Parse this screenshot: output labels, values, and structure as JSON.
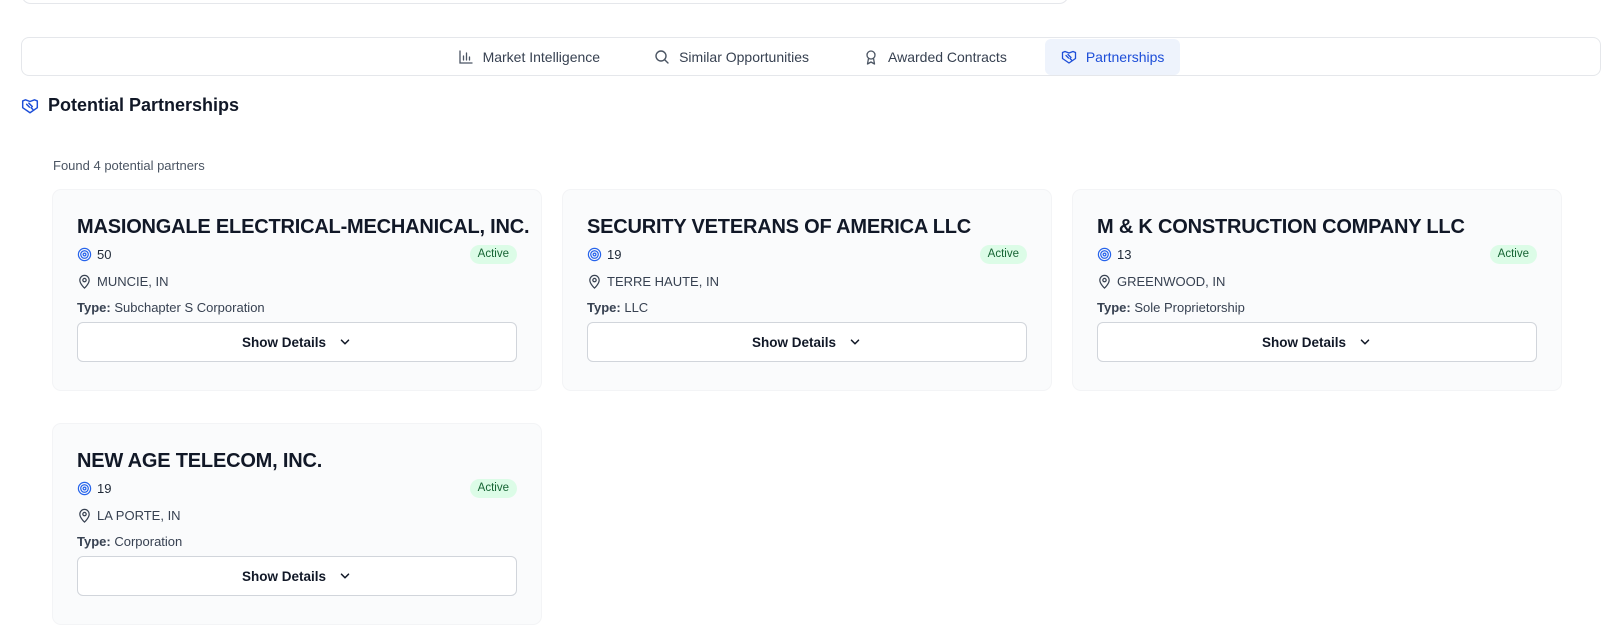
{
  "tabs": [
    {
      "label": "Market Intelligence",
      "icon": "bar-chart-icon",
      "active": false
    },
    {
      "label": "Similar Opportunities",
      "icon": "search-icon",
      "active": false
    },
    {
      "label": "Awarded Contracts",
      "icon": "award-icon",
      "active": false
    },
    {
      "label": "Partnerships",
      "icon": "handshake-icon",
      "active": true
    }
  ],
  "section": {
    "title": "Potential Partnerships",
    "found_text": "Found 4 potential partners"
  },
  "colors": {
    "accent": "#1d4ed8",
    "active_tab_bg": "#eef3fc",
    "badge_bg": "#dcfce7",
    "badge_text": "#166534"
  },
  "partners": [
    {
      "name": "MASIONGALE ELECTRICAL-MECHANICAL, INC.",
      "score": "50",
      "status": "Active",
      "location": "MUNCIE, IN",
      "type_label": "Type:",
      "type": "Subchapter S Corporation",
      "button": "Show Details"
    },
    {
      "name": "SECURITY VETERANS OF AMERICA LLC",
      "score": "19",
      "status": "Active",
      "location": "TERRE HAUTE, IN",
      "type_label": "Type:",
      "type": "LLC",
      "button": "Show Details"
    },
    {
      "name": "M & K CONSTRUCTION COMPANY LLC",
      "score": "13",
      "status": "Active",
      "location": "GREENWOOD, IN",
      "type_label": "Type:",
      "type": "Sole Proprietorship",
      "button": "Show Details"
    },
    {
      "name": "NEW AGE TELECOM, INC.",
      "score": "19",
      "status": "Active",
      "location": "LA PORTE, IN",
      "type_label": "Type:",
      "type": "Corporation",
      "button": "Show Details"
    }
  ]
}
